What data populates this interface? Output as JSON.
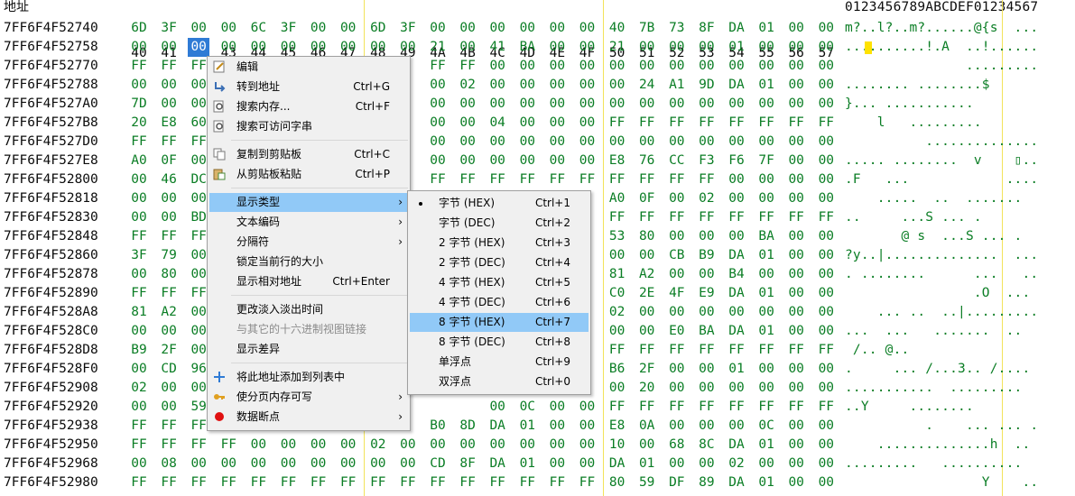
{
  "header": {
    "address_label": "地址",
    "columns": [
      "40",
      "41",
      "42",
      "43",
      "44",
      "45",
      "46",
      "47",
      "48",
      "49",
      "4A",
      "4B",
      "4C",
      "4D",
      "4E",
      "4F",
      "50",
      "51",
      "52",
      "53",
      "54",
      "55",
      "56",
      "57"
    ],
    "ascii_label": "0123456789ABCDEF01234567"
  },
  "rows": [
    {
      "address": "7FF6F4F52740",
      "bytes": [
        "6D",
        "3F",
        "00",
        "00",
        "6C",
        "3F",
        "00",
        "00",
        "6D",
        "3F",
        "00",
        "00",
        "00",
        "00",
        "00",
        "00",
        "40",
        "7B",
        "73",
        "8F",
        "DA",
        "01",
        "00",
        "00"
      ],
      "ascii": "m?..l?..m?......@{s  ..."
    },
    {
      "address": "7FF6F4F52758",
      "bytes": [
        "00",
        "00",
        "00",
        "00",
        "00",
        "00",
        "00",
        "00",
        "00",
        "00",
        "21",
        "00",
        "41",
        "BA",
        "00",
        "00",
        "21",
        "00",
        "00",
        "00",
        "01",
        "00",
        "00",
        "00"
      ],
      "ascii": "..........!.A  ..!......"
    },
    {
      "address": "7FF6F4F52770",
      "bytes": [
        "FF",
        "FF",
        "FF",
        "",
        "",
        "",
        "",
        "",
        "",
        "",
        "FF",
        "FF",
        "00",
        "00",
        "00",
        "00",
        "00",
        "00",
        "00",
        "00",
        "00",
        "00",
        "00",
        "00"
      ],
      "ascii": "               ........."
    },
    {
      "address": "7FF6F4F52788",
      "bytes": [
        "00",
        "00",
        "00",
        "",
        "",
        "",
        "",
        "",
        "",
        "",
        "00",
        "02",
        "00",
        "00",
        "00",
        "00",
        "00",
        "24",
        "A1",
        "9D",
        "DA",
        "01",
        "00",
        "00"
      ],
      "ascii": "........ ........$      "
    },
    {
      "address": "7FF6F4F527A0",
      "bytes": [
        "7D",
        "00",
        "00",
        "",
        "",
        "",
        "",
        "",
        "",
        "",
        "00",
        "00",
        "00",
        "00",
        "00",
        "00",
        "00",
        "00",
        "00",
        "00",
        "00",
        "00",
        "00",
        "00"
      ],
      "ascii": "}... ...........        "
    },
    {
      "address": "7FF6F4F527B8",
      "bytes": [
        "20",
        "E8",
        "60",
        "",
        "",
        "",
        "",
        "",
        "",
        "",
        "00",
        "00",
        "04",
        "00",
        "00",
        "00",
        "FF",
        "FF",
        "FF",
        "FF",
        "FF",
        "FF",
        "FF",
        "FF"
      ],
      "ascii": "    l   .........       "
    },
    {
      "address": "7FF6F4F527D0",
      "bytes": [
        "FF",
        "FF",
        "FF",
        "",
        "",
        "",
        "",
        "",
        "",
        "",
        "00",
        "00",
        "00",
        "00",
        "00",
        "00",
        "00",
        "00",
        "00",
        "00",
        "00",
        "00",
        "00",
        "00"
      ],
      "ascii": "          .............."
    },
    {
      "address": "7FF6F4F527E8",
      "bytes": [
        "A0",
        "0F",
        "00",
        "",
        "",
        "",
        "",
        "",
        "",
        "",
        "00",
        "00",
        "00",
        "00",
        "00",
        "00",
        "E8",
        "76",
        "CC",
        "F3",
        "F6",
        "7F",
        "00",
        "00"
      ],
      "ascii": "..... ........  v    ▯.."
    },
    {
      "address": "7FF6F4F52800",
      "bytes": [
        "00",
        "46",
        "DC",
        "",
        "",
        "",
        "",
        "",
        "",
        "",
        "FF",
        "FF",
        "FF",
        "FF",
        "FF",
        "FF",
        "FF",
        "FF",
        "FF",
        "FF",
        "00",
        "00",
        "00",
        "00"
      ],
      "ascii": ".F   ...            ...."
    },
    {
      "address": "7FF6F4F52818",
      "bytes": [
        "00",
        "00",
        "00",
        "",
        "",
        "",
        "",
        "",
        "",
        "",
        "",
        "",
        "",
        "",
        "",
        "",
        "A0",
        "0F",
        "00",
        "02",
        "00",
        "00",
        "00",
        "00"
      ],
      "ascii": "    .....  ..  .......  "
    },
    {
      "address": "7FF6F4F52830",
      "bytes": [
        "00",
        "00",
        "BD",
        "",
        "",
        "",
        "",
        "",
        "",
        "",
        "",
        "",
        "",
        "",
        "",
        "",
        "FF",
        "FF",
        "FF",
        "FF",
        "FF",
        "FF",
        "FF",
        "FF"
      ],
      "ascii": "..     ...S ... .       "
    },
    {
      "address": "7FF6F4F52848",
      "bytes": [
        "FF",
        "FF",
        "FF",
        "",
        "",
        "",
        "",
        "",
        "",
        "",
        "",
        "",
        "",
        "",
        "",
        "",
        "53",
        "80",
        "00",
        "00",
        "00",
        "BA",
        "00",
        "00"
      ],
      "ascii": "       @ s  ...S ... .  "
    },
    {
      "address": "7FF6F4F52860",
      "bytes": [
        "3F",
        "79",
        "00",
        "",
        "",
        "",
        "",
        "",
        "",
        "",
        "",
        "",
        "",
        "",
        "",
        "",
        "00",
        "00",
        "CB",
        "B9",
        "DA",
        "01",
        "00",
        "00"
      ],
      "ascii": "?y..|..............  ..."
    },
    {
      "address": "7FF6F4F52878",
      "bytes": [
        "00",
        "80",
        "00",
        "",
        "",
        "",
        "",
        "",
        "",
        "",
        "",
        "",
        "",
        "",
        "",
        "",
        "81",
        "A2",
        "00",
        "00",
        "B4",
        "00",
        "00",
        "00"
      ],
      "ascii": ". ........      ...   .."
    },
    {
      "address": "7FF6F4F52890",
      "bytes": [
        "FF",
        "FF",
        "FF",
        "",
        "",
        "",
        "",
        "",
        "",
        "",
        "",
        "",
        "",
        "",
        "",
        "",
        "C0",
        "2E",
        "4F",
        "E9",
        "DA",
        "01",
        "00",
        "00"
      ],
      "ascii": "                .O  ... "
    },
    {
      "address": "7FF6F4F528A8",
      "bytes": [
        "81",
        "A2",
        "00",
        "",
        "",
        "",
        "",
        "",
        "",
        "",
        "",
        "",
        "",
        "",
        "",
        "",
        "02",
        "00",
        "00",
        "00",
        "00",
        "00",
        "00",
        "00"
      ],
      "ascii": "    ... ..  ..|........."
    },
    {
      "address": "7FF6F4F528C0",
      "bytes": [
        "00",
        "00",
        "00",
        "",
        "",
        "",
        "",
        "",
        "",
        "",
        "",
        "",
        "",
        "",
        "",
        "",
        "00",
        "00",
        "E0",
        "BA",
        "DA",
        "01",
        "00",
        "00"
      ],
      "ascii": "...  ...   .......  ..  "
    },
    {
      "address": "7FF6F4F528D8",
      "bytes": [
        "B9",
        "2F",
        "00",
        "",
        "",
        "",
        "",
        "",
        "",
        "",
        "",
        "",
        "",
        "",
        "",
        "",
        "FF",
        "FF",
        "FF",
        "FF",
        "FF",
        "FF",
        "FF",
        "FF"
      ],
      "ascii": " /.. @..                "
    },
    {
      "address": "7FF6F4F528F0",
      "bytes": [
        "00",
        "CD",
        "96",
        "",
        "",
        "",
        "",
        "",
        "",
        "",
        "",
        "",
        "",
        "",
        "",
        "",
        "B6",
        "2F",
        "00",
        "00",
        "01",
        "00",
        "00",
        "00"
      ],
      "ascii": ".     ... /...3.. /.... "
    },
    {
      "address": "7FF6F4F52908",
      "bytes": [
        "02",
        "00",
        "00",
        "",
        "",
        "",
        "",
        "",
        "",
        "",
        "",
        "",
        "",
        "",
        "",
        "",
        "00",
        "20",
        "00",
        "00",
        "00",
        "00",
        "00",
        "00"
      ],
      "ascii": "...........  .........  "
    },
    {
      "address": "7FF6F4F52920",
      "bytes": [
        "00",
        "00",
        "59",
        "",
        "",
        "",
        "",
        "",
        "",
        "",
        "",
        "",
        "00",
        "0C",
        "00",
        "00",
        "FF",
        "FF",
        "FF",
        "FF",
        "FF",
        "FF",
        "FF",
        "FF"
      ],
      "ascii": "..Y     ........        "
    },
    {
      "address": "7FF6F4F52938",
      "bytes": [
        "FF",
        "FF",
        "FF",
        "",
        "",
        "",
        "",
        "",
        "",
        "",
        "B0",
        "8D",
        "DA",
        "01",
        "00",
        "00",
        "E8",
        "0A",
        "00",
        "00",
        "00",
        "0C",
        "00",
        "00"
      ],
      "ascii": "          .    ... ... ."
    },
    {
      "address": "7FF6F4F52950",
      "bytes": [
        "FF",
        "FF",
        "FF",
        "FF",
        "00",
        "00",
        "00",
        "00",
        "02",
        "00",
        "00",
        "00",
        "00",
        "00",
        "00",
        "00",
        "10",
        "00",
        "68",
        "8C",
        "DA",
        "01",
        "00",
        "00"
      ],
      "ascii": "    ..............h  .. "
    },
    {
      "address": "7FF6F4F52968",
      "bytes": [
        "00",
        "08",
        "00",
        "00",
        "00",
        "00",
        "00",
        "00",
        "00",
        "00",
        "CD",
        "8F",
        "DA",
        "01",
        "00",
        "00",
        "DA",
        "01",
        "00",
        "00",
        "02",
        "00",
        "00",
        "00"
      ],
      "ascii": ".........   ..........  "
    },
    {
      "address": "7FF6F4F52980",
      "bytes": [
        "FF",
        "FF",
        "FF",
        "FF",
        "FF",
        "FF",
        "FF",
        "FF",
        "FF",
        "FF",
        "FF",
        "FF",
        "FF",
        "FF",
        "FF",
        "FF",
        "80",
        "59",
        "DF",
        "89",
        "DA",
        "01",
        "00",
        "00"
      ],
      "ascii": "                 Y    .."
    }
  ],
  "context_menu": {
    "items": [
      {
        "label": "编辑",
        "shortcut": "",
        "icon": "edit-icon"
      },
      {
        "label": "转到地址",
        "shortcut": "Ctrl+G",
        "icon": "goto-address-icon"
      },
      {
        "label": "搜索内存...",
        "shortcut": "Ctrl+F",
        "icon": "search-icon"
      },
      {
        "label": "搜索可访问字串",
        "shortcut": "",
        "icon": "search-strings-icon"
      },
      {
        "label": "复制到剪贴板",
        "shortcut": "Ctrl+C",
        "icon": "copy-icon"
      },
      {
        "label": "从剪贴板粘贴",
        "shortcut": "Ctrl+P",
        "icon": "paste-icon"
      },
      {
        "label": "显示类型",
        "shortcut": ""
      },
      {
        "label": "文本编码",
        "shortcut": ""
      },
      {
        "label": "分隔符",
        "shortcut": ""
      },
      {
        "label": "锁定当前行的大小",
        "shortcut": ""
      },
      {
        "label": "显示相对地址",
        "shortcut": "Ctrl+Enter"
      },
      {
        "label": "更改淡入淡出时间",
        "shortcut": ""
      },
      {
        "label": "与其它的十六进制视图链接",
        "shortcut": ""
      },
      {
        "label": "显示差异",
        "shortcut": ""
      },
      {
        "label": "将此地址添加到列表中",
        "shortcut": "",
        "icon": "add-icon"
      },
      {
        "label": "使分页内存可写",
        "shortcut": "",
        "icon": "key-icon"
      },
      {
        "label": "数据断点",
        "shortcut": "",
        "icon": "breakpoint-icon"
      }
    ]
  },
  "submenu": {
    "items": [
      {
        "label": "字节 (HEX)",
        "shortcut": "Ctrl+1",
        "checked": true
      },
      {
        "label": "字节 (DEC)",
        "shortcut": "Ctrl+2"
      },
      {
        "label": "2 字节 (HEX)",
        "shortcut": "Ctrl+3"
      },
      {
        "label": "2 字节 (DEC)",
        "shortcut": "Ctrl+4"
      },
      {
        "label": "4 字节 (HEX)",
        "shortcut": "Ctrl+5"
      },
      {
        "label": "4 字节 (DEC)",
        "shortcut": "Ctrl+6"
      },
      {
        "label": "8 字节 (HEX)",
        "shortcut": "Ctrl+7"
      },
      {
        "label": "8 字节 (DEC)",
        "shortcut": "Ctrl+8"
      },
      {
        "label": "单浮点",
        "shortcut": "Ctrl+9"
      },
      {
        "label": "双浮点",
        "shortcut": "Ctrl+0"
      }
    ]
  },
  "colors": {
    "hex_text": "#0a7d24",
    "selection": "#2f7bd5",
    "menu_highlight": "#91c9f7",
    "column_rule": "#f2e35a",
    "ascii_cursor": "#ffe200"
  }
}
